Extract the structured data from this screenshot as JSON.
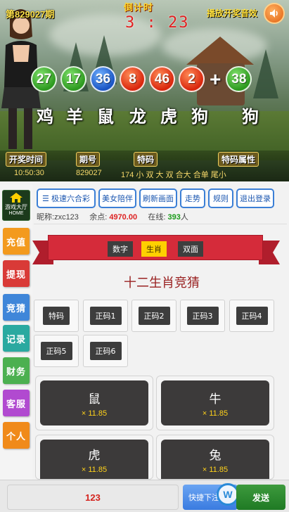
{
  "banner": {
    "period": "第829027期",
    "countdown_label": "倒计时",
    "countdown": "3 : 23",
    "sound_label": "播放开奖音效",
    "balls": [
      {
        "num": "27",
        "color": "green"
      },
      {
        "num": "17",
        "color": "green"
      },
      {
        "num": "36",
        "color": "blue"
      },
      {
        "num": "8",
        "color": "red"
      },
      {
        "num": "46",
        "color": "red"
      },
      {
        "num": "2",
        "color": "red"
      },
      {
        "num": "38",
        "color": "green"
      }
    ],
    "zodiacs": [
      "鸡",
      "羊",
      "鼠",
      "龙",
      "虎",
      "狗",
      "狗"
    ],
    "info": {
      "time_label": "开奖时间",
      "time_value": "10:50:30",
      "period_label": "期号",
      "period_value": "829027",
      "special_label": "特码",
      "special_value": "174  小  双  大  双  合大  合单  尾小",
      "attr_label": "特码属性"
    }
  },
  "side": {
    "home": "游戏大厅",
    "home_sub": "HOME",
    "items": [
      {
        "label": "充值",
        "color": "#f39a1e"
      },
      {
        "label": "提现",
        "color": "#d93a37"
      },
      {
        "label": "竞猜",
        "color": "#3f86d9"
      },
      {
        "label": "记录",
        "color": "#2aa9a0"
      },
      {
        "label": "财务",
        "color": "#4cb050"
      },
      {
        "label": "客服",
        "color": "#b14ad0"
      },
      {
        "label": "个人",
        "color": "#f08a1a"
      }
    ]
  },
  "toolbar": {
    "buttons": [
      "☰ 极速六合彩",
      "美女陪伴",
      "刷新画面",
      "走势",
      "规则",
      "退出登录"
    ]
  },
  "user": {
    "nick_label": "昵称:",
    "nick": "zxc123",
    "balance_label": "余点",
    "balance": "4970.00",
    "online_label": "在线",
    "online": "393",
    "online_unit": "人"
  },
  "ribbon_tabs": [
    {
      "label": "数字",
      "active": false
    },
    {
      "label": "生肖",
      "active": true
    },
    {
      "label": "双面",
      "active": false
    }
  ],
  "section_title": "十二生肖竞猜",
  "code_types": [
    "特码",
    "正码1",
    "正码2",
    "正码3",
    "正码4",
    "正码5",
    "正码6"
  ],
  "zodiac_cards": [
    {
      "name": "鼠",
      "odds": "× 11.85"
    },
    {
      "name": "牛",
      "odds": "× 11.85"
    },
    {
      "name": "虎",
      "odds": "× 11.85"
    },
    {
      "name": "兔",
      "odds": "× 11.85"
    }
  ],
  "bottom": {
    "amount": "123",
    "quick_label": "快捷下注",
    "send_label": "发送"
  }
}
